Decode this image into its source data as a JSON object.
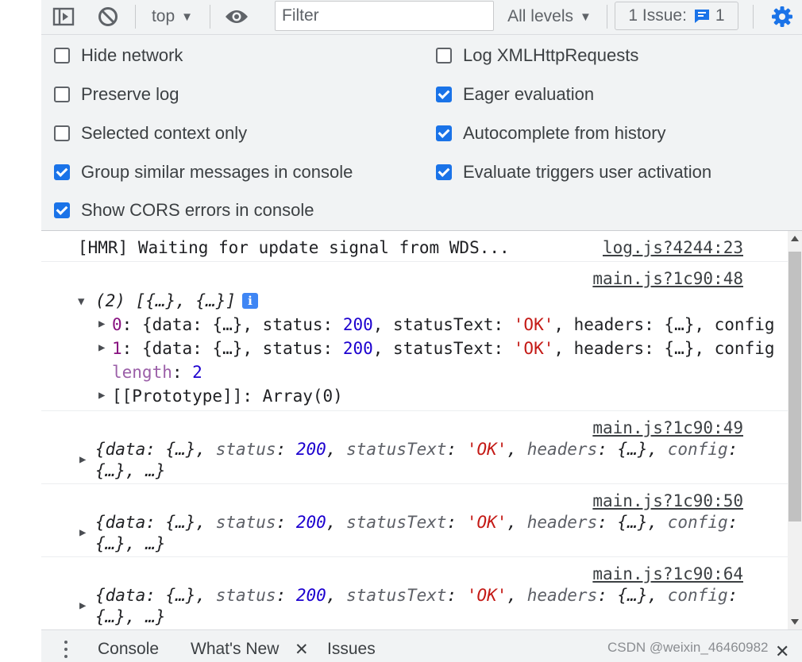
{
  "toolbar": {
    "context": "top",
    "filter_placeholder": "Filter",
    "levels": "All levels",
    "issues_label": "1 Issue:",
    "issues_count": "1"
  },
  "settings": {
    "left": [
      {
        "label": "Hide network",
        "checked": false
      },
      {
        "label": "Preserve log",
        "checked": false
      },
      {
        "label": "Selected context only",
        "checked": false
      },
      {
        "label": "Group similar messages in console",
        "checked": true
      },
      {
        "label": "Show CORS errors in console",
        "checked": true
      }
    ],
    "right": [
      {
        "label": "Log XMLHttpRequests",
        "checked": false
      },
      {
        "label": "Eager evaluation",
        "checked": true
      },
      {
        "label": "Autocomplete from history",
        "checked": true
      },
      {
        "label": "Evaluate triggers user activation",
        "checked": true
      }
    ]
  },
  "console": {
    "hmr": {
      "text": "[HMR] Waiting for update signal from WDS...",
      "source": "log.js?4244:23"
    },
    "array_msg": {
      "source": "main.js?1c90:48",
      "summary": "(2) [{…}, {…}]",
      "info": "i",
      "items": [
        {
          "index": "0",
          "d1": "{data: {…}, status: ",
          "status": "200",
          "d2": ", statusText: ",
          "statusText": "'OK'",
          "d3": ", headers: {…}, config"
        },
        {
          "index": "1",
          "d1": "{data: {…}, status: ",
          "status": "200",
          "d2": ", statusText: ",
          "statusText": "'OK'",
          "d3": ", headers: {…}, config"
        }
      ],
      "length_key": "length",
      "length_val": "2",
      "prototype": "[[Prototype]]: Array(0)"
    },
    "objects": [
      {
        "source": "main.js?1c90:49"
      },
      {
        "source": "main.js?1c90:50"
      },
      {
        "source": "main.js?1c90:64"
      }
    ],
    "object_line": {
      "p1": "{data: {…}, ",
      "status_key": "status",
      "status_val": "200",
      "text_key": "statusText",
      "text_val": "'OK'",
      "headers_key": "headers",
      "headers_val": "{…}",
      "config_key": "config",
      "tail": "{…}, …}"
    }
  },
  "drawer": {
    "console": "Console",
    "whats_new": "What's New",
    "issues": "Issues",
    "close": "✕"
  },
  "watermark": "CSDN @weixin_46460982",
  "colors": {
    "accent": "#1a73e8",
    "number": "#1c00cf",
    "string": "#c41a16",
    "key": "#881280"
  }
}
